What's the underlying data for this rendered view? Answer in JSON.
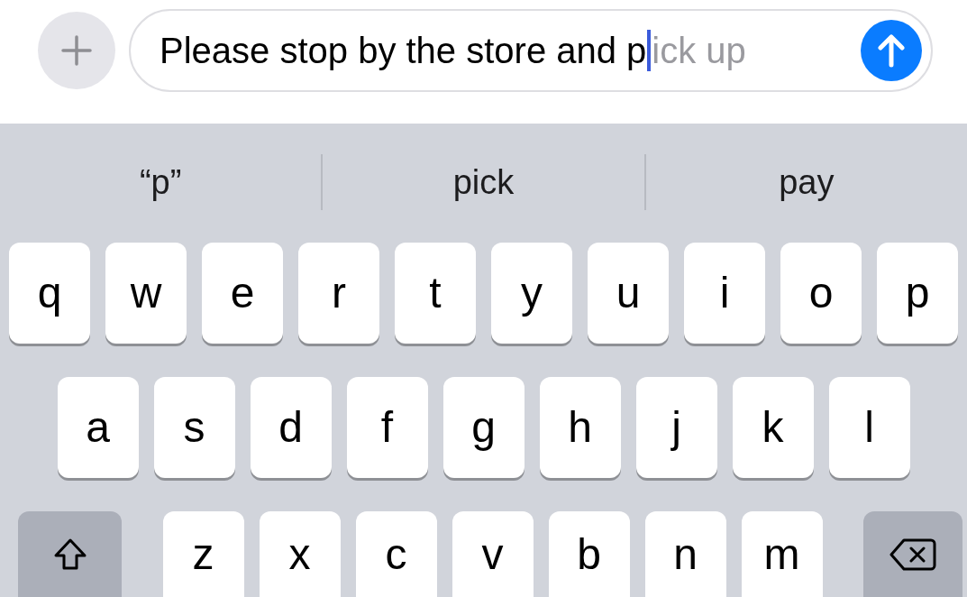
{
  "compose_bar": {
    "typed_text": "Please stop by the store and p",
    "predicted_text": "ick up"
  },
  "suggestions": [
    "“p”",
    "pick",
    "pay"
  ],
  "key_rows": [
    [
      "q",
      "w",
      "e",
      "r",
      "t",
      "y",
      "u",
      "i",
      "o",
      "p"
    ],
    [
      "a",
      "s",
      "d",
      "f",
      "g",
      "h",
      "j",
      "k",
      "l"
    ],
    [
      "z",
      "x",
      "c",
      "v",
      "b",
      "n",
      "m"
    ]
  ]
}
